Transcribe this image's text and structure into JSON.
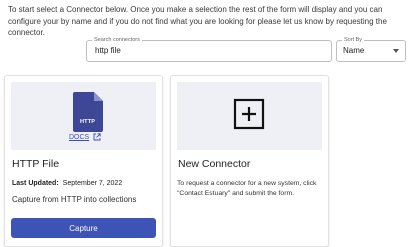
{
  "intro": {
    "text": "To start select a Connector below. Once you make a selection the rest of the form will display and you can configure your by name and if you do not find what you are looking for please let us know by requesting the connector."
  },
  "search": {
    "label": "Search connectors",
    "value": "http file"
  },
  "sort": {
    "label": "Sort By",
    "value": "Name"
  },
  "cards": [
    {
      "icon_text": "HTTP",
      "docs_label": "DOCS",
      "title": "HTTP File",
      "last_updated_label": "Last Updated:",
      "last_updated_value": "September 7, 2022",
      "description": "Capture from HTTP into collections",
      "button_label": "Capture"
    },
    {
      "title": "New Connector",
      "description": "To request a connector for a new system, click \"Contact Estuary\" and submit the form."
    }
  ],
  "colors": {
    "accent": "#3d53b6",
    "file_icon": "#3d4796",
    "card_media_bg": "#eef0f5"
  }
}
